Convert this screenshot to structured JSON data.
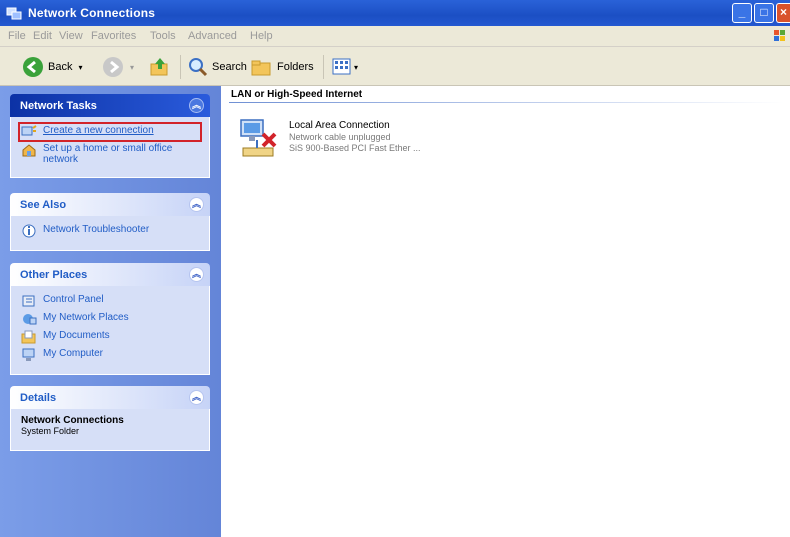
{
  "window": {
    "title": "Network Connections"
  },
  "menubar": {
    "items": [
      "File",
      "Edit",
      "View",
      "Favorites",
      "Tools",
      "Advanced",
      "Help"
    ]
  },
  "toolbar": {
    "back_label": "Back",
    "search_label": "Search",
    "folders_label": "Folders"
  },
  "sidebar": {
    "network_tasks": {
      "title": "Network Tasks",
      "items": [
        {
          "label": "Create a new connection",
          "icon": "new-connection-icon"
        },
        {
          "label": "Set up a home or small office network",
          "icon": "home-network-icon"
        }
      ]
    },
    "see_also": {
      "title": "See Also",
      "items": [
        {
          "label": "Network Troubleshooter",
          "icon": "troubleshooter-icon"
        }
      ]
    },
    "other_places": {
      "title": "Other Places",
      "items": [
        {
          "label": "Control Panel",
          "icon": "control-panel-icon"
        },
        {
          "label": "My Network Places",
          "icon": "network-places-icon"
        },
        {
          "label": "My Documents",
          "icon": "documents-folder-icon"
        },
        {
          "label": "My Computer",
          "icon": "computer-icon"
        }
      ]
    },
    "details": {
      "title": "Details",
      "name": "Network Connections",
      "type": "System Folder"
    }
  },
  "main": {
    "group_title": "LAN or High-Speed Internet",
    "connection": {
      "name": "Local Area Connection",
      "status": "Network cable unplugged",
      "device": "SiS 900-Based PCI Fast Ether ..."
    }
  },
  "colors": {
    "title_bar": "#1b4fc4",
    "task_pane": "#6f91df",
    "link": "#215dc6",
    "highlight_box": "#d2232a"
  }
}
